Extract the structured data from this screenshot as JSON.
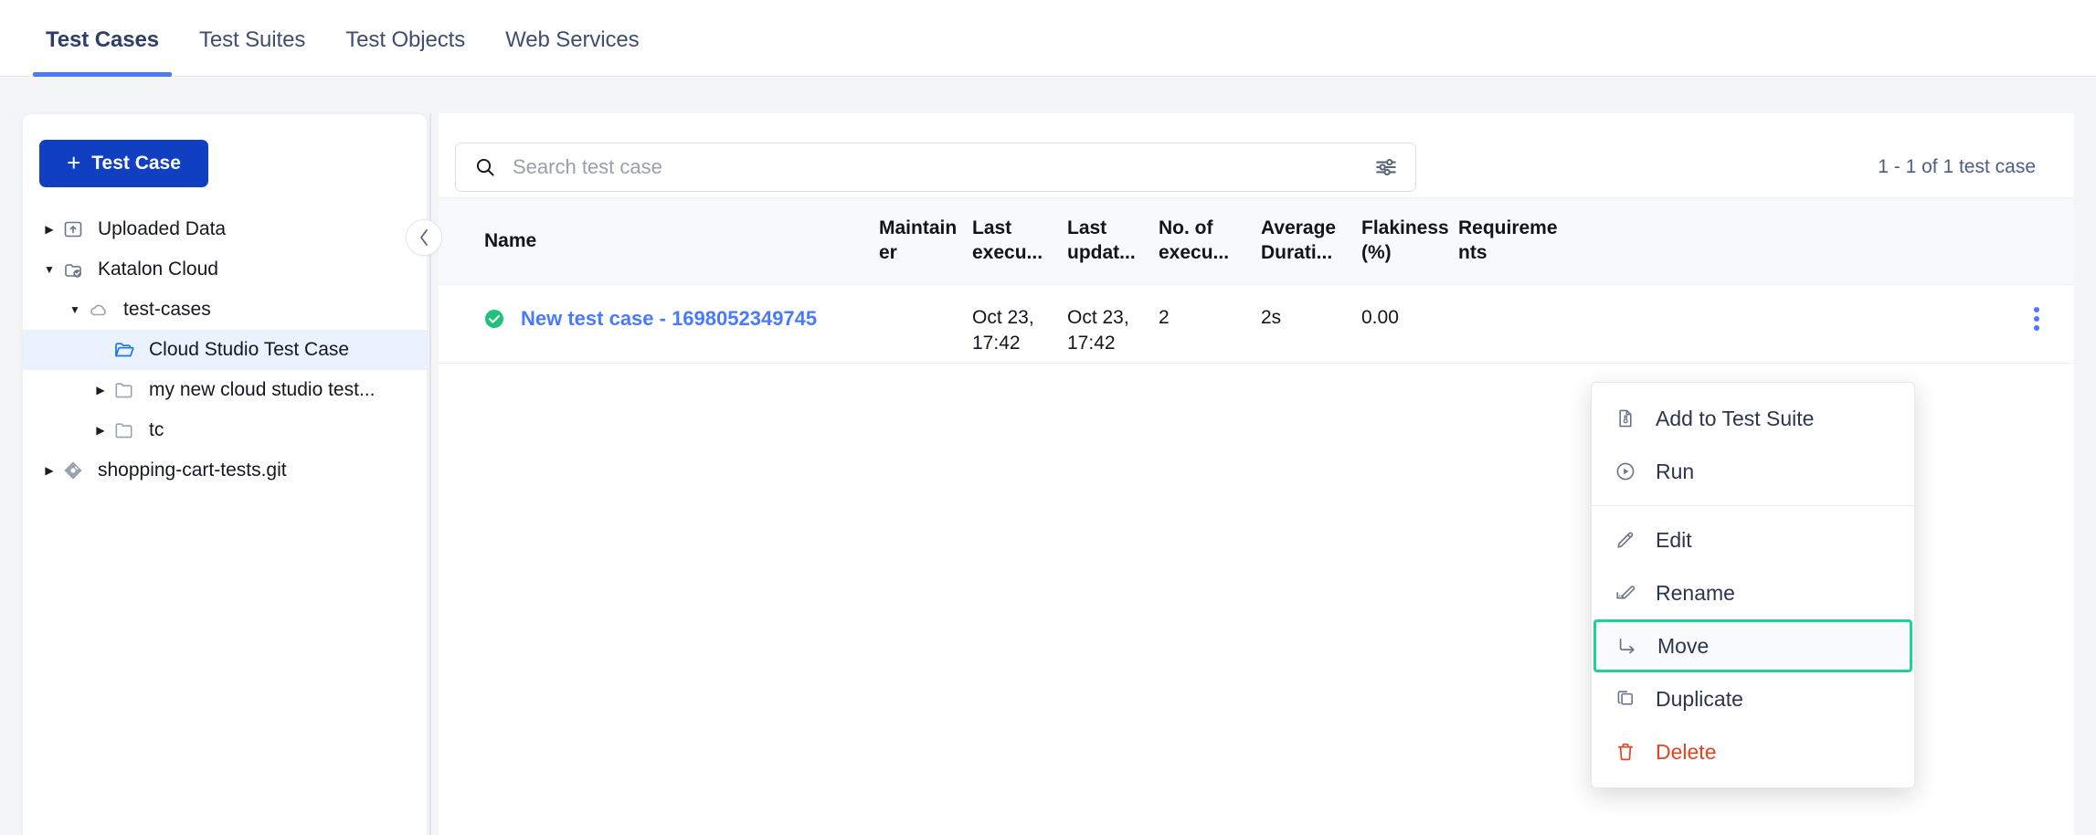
{
  "tabs": [
    {
      "label": "Test Cases",
      "active": true
    },
    {
      "label": "Test Suites",
      "active": false
    },
    {
      "label": "Test Objects",
      "active": false
    },
    {
      "label": "Web Services",
      "active": false
    }
  ],
  "sidebar": {
    "new_button_label": "Test Case",
    "new_button_plus": "+",
    "tree": [
      {
        "label": "Uploaded Data",
        "depth": 0,
        "caret": "collapsed",
        "icon": "upload-folder-icon",
        "selected": false
      },
      {
        "label": "Katalon Cloud",
        "depth": 0,
        "caret": "expanded",
        "icon": "cloud-check-icon",
        "selected": false
      },
      {
        "label": "test-cases",
        "depth": 1,
        "caret": "expanded",
        "icon": "cloud-icon",
        "selected": false
      },
      {
        "label": "Cloud Studio Test Case",
        "depth": 2,
        "caret": "none",
        "icon": "folder-open-icon",
        "selected": true
      },
      {
        "label": "my new cloud studio test...",
        "depth": 2,
        "caret": "collapsed",
        "icon": "folder-icon",
        "selected": false
      },
      {
        "label": "tc",
        "depth": 2,
        "caret": "collapsed",
        "icon": "folder-icon",
        "selected": false
      },
      {
        "label": "shopping-cart-tests.git",
        "depth": 0,
        "caret": "collapsed",
        "icon": "git-icon",
        "selected": false
      }
    ],
    "collapse_icon": "chevron-left-icon"
  },
  "toolbar": {
    "search_placeholder": "Search test case",
    "search_value": "",
    "search_icon": "search-icon",
    "filter_icon": "sliders-icon",
    "pagination": "1 - 1 of 1 test case"
  },
  "table": {
    "columns": [
      {
        "key": "name",
        "label": "Name"
      },
      {
        "key": "maintainer",
        "label": "Maintainer"
      },
      {
        "key": "last_execution",
        "label": "Last execu..."
      },
      {
        "key": "last_updated",
        "label": "Last updat..."
      },
      {
        "key": "no_of_executions",
        "label": "No. of execu..."
      },
      {
        "key": "average_duration",
        "label": "Average Durati..."
      },
      {
        "key": "flakiness",
        "label": "Flakiness (%)"
      },
      {
        "key": "requirements",
        "label": "Requirements"
      }
    ],
    "rows": [
      {
        "status_icon": "check-circle-icon",
        "name": "New test case - 1698052349745",
        "maintainer": "",
        "last_execution": "Oct 23, 17:42",
        "last_updated": "Oct 23, 17:42",
        "no_of_executions": "2",
        "average_duration": "2s",
        "flakiness": "0.00",
        "requirements": "",
        "menu_icon": "kebab-menu-icon"
      }
    ]
  },
  "context_menu": {
    "items": [
      {
        "label": "Add to Test Suite",
        "icon": "test-suite-icon",
        "highlighted": false,
        "danger": false
      },
      {
        "label": "Run",
        "icon": "play-circle-icon",
        "highlighted": false,
        "danger": false
      },
      {
        "separator": true
      },
      {
        "label": "Edit",
        "icon": "pencil-icon",
        "highlighted": false,
        "danger": false
      },
      {
        "label": "Rename",
        "icon": "rename-icon",
        "highlighted": false,
        "danger": false
      },
      {
        "label": "Move",
        "icon": "arrow-move-icon",
        "highlighted": true,
        "danger": false
      },
      {
        "label": "Duplicate",
        "icon": "copy-icon",
        "highlighted": false,
        "danger": false
      },
      {
        "label": "Delete",
        "icon": "trash-icon",
        "highlighted": false,
        "danger": true
      }
    ]
  },
  "colors": {
    "accent_blue": "#4a7afc",
    "primary_button": "#1040c1",
    "highlight_green": "#21d194",
    "status_green": "#21c17a",
    "danger_red": "#e8431f",
    "selected_row": "#eaf2fe"
  }
}
